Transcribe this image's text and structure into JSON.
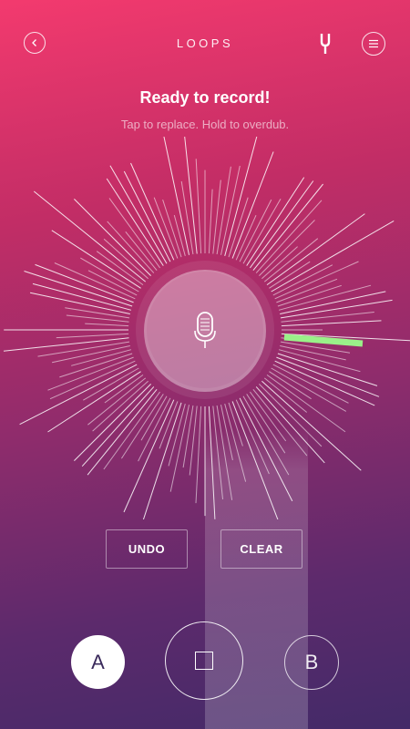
{
  "header": {
    "title": "LOOPS",
    "back_icon": "chevron-left-icon",
    "tuner_icon": "tuning-fork-icon",
    "menu_icon": "menu-icon"
  },
  "status": {
    "headline": "Ready to record!",
    "hint": "Tap to replace. Hold to overdub."
  },
  "recorder": {
    "mic_icon": "microphone-icon",
    "progress_color": "#9af089",
    "ring_color": "#ffffff"
  },
  "actions": {
    "undo_label": "UNDO",
    "clear_label": "CLEAR"
  },
  "slots": {
    "a_label": "A",
    "b_label": "B",
    "stop_icon": "stop-icon"
  },
  "colors": {
    "bg_top": "#f33a6e",
    "bg_bottom": "#432a68"
  }
}
